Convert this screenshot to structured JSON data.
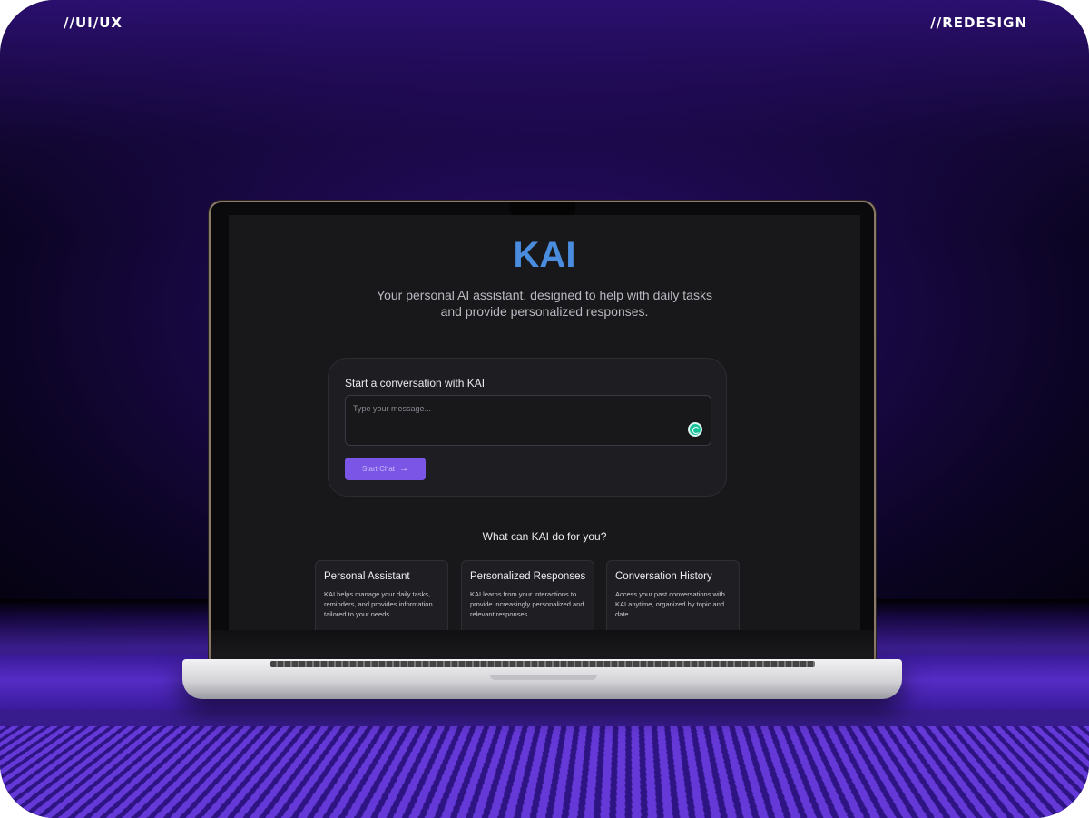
{
  "corner_tags": {
    "left": "//UI/UX",
    "right": "//REDESIGN"
  },
  "app": {
    "title": "KAI",
    "subtitle": "Your personal AI assistant, designed to help with daily tasks and provide personalized responses."
  },
  "chat": {
    "label": "Start a conversation with KAI",
    "input_placeholder": "Type your message...",
    "button_label": "Start Chat",
    "accent_color": "#7a55e6"
  },
  "features": {
    "heading": "What can KAI do for you?",
    "items": [
      {
        "title": "Personal Assistant",
        "description": "KAI helps manage your daily tasks, reminders, and provides information tailored to your needs."
      },
      {
        "title": "Personalized Responses",
        "description": "KAI learns from your interactions to provide increasingly personalized and relevant responses."
      },
      {
        "title": "Conversation History",
        "description": "Access your past conversations with KAI anytime, organized by topic and date."
      }
    ]
  },
  "colors": {
    "brand": "#4a8cde",
    "background": "#18181b",
    "card": "#1e1e22"
  },
  "icons": {
    "input_tool": "grammarly-icon",
    "button_arrow": "arrow-right-icon"
  }
}
